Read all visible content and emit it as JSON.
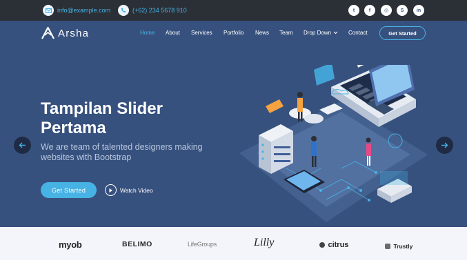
{
  "topbar": {
    "email": "info@example.com",
    "phone": "(+62) 234 5678 910",
    "social": [
      {
        "icon": "twitter-icon",
        "glyph": "t"
      },
      {
        "icon": "facebook-icon",
        "glyph": "f"
      },
      {
        "icon": "instagram-icon",
        "glyph": "◎"
      },
      {
        "icon": "skype-icon",
        "glyph": "S"
      },
      {
        "icon": "linkedin-icon",
        "glyph": "in"
      }
    ]
  },
  "header": {
    "logo_text": "Arsha",
    "nav": [
      "Home",
      "About",
      "Services",
      "Portfolio",
      "News",
      "Team",
      "Drop Down",
      "Contact"
    ],
    "active_nav": "Home",
    "cta_label": "Get Started"
  },
  "hero": {
    "title": "Tampilan Slider Pertama",
    "subtitle": "We are team of talented designers making websites with Bootstrap",
    "primary_button": "Get Started",
    "video_link": "Watch Video"
  },
  "clients": [
    "myob",
    "BELIMO",
    "LifeGroups",
    "Lilly",
    "citrus",
    "Trustly"
  ],
  "colors": {
    "topbar": "#2b2f36",
    "hero": "#37517e",
    "accent": "#47b2e4",
    "clients_bg": "#f3f5fa"
  }
}
